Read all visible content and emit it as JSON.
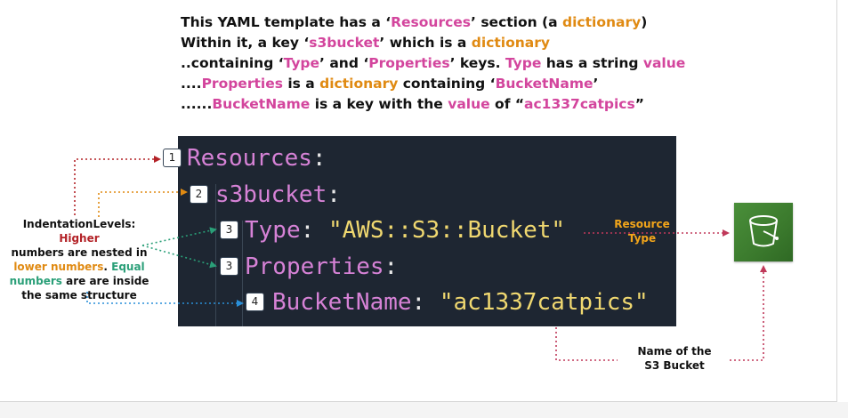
{
  "description": {
    "line1": [
      {
        "text": "This YAML template has a ‘",
        "color": "dark"
      },
      {
        "text": "Resources",
        "color": "pink"
      },
      {
        "text": "’ section (a ",
        "color": "dark"
      },
      {
        "text": "dictionary",
        "color": "orange"
      },
      {
        "text": ")",
        "color": "dark"
      }
    ],
    "line2": [
      {
        "text": "Within it, a key ‘",
        "color": "dark"
      },
      {
        "text": "s3bucket",
        "color": "pink"
      },
      {
        "text": "’ which is a ",
        "color": "dark"
      },
      {
        "text": "dictionary",
        "color": "orange"
      }
    ],
    "line3": [
      {
        "text": "..containing ‘",
        "color": "dark"
      },
      {
        "text": "Type",
        "color": "pink"
      },
      {
        "text": "’ and ‘",
        "color": "dark"
      },
      {
        "text": "Properties",
        "color": "pink"
      },
      {
        "text": "’ keys. ",
        "color": "dark"
      },
      {
        "text": "Type",
        "color": "pink"
      },
      {
        "text": " has a string ",
        "color": "dark"
      },
      {
        "text": "value",
        "color": "pink"
      }
    ],
    "line4": [
      {
        "text": "....",
        "color": "dark"
      },
      {
        "text": "Properties",
        "color": "pink"
      },
      {
        "text": " is a ",
        "color": "dark"
      },
      {
        "text": "dictionary",
        "color": "orange"
      },
      {
        "text": " containing ‘",
        "color": "dark"
      },
      {
        "text": "BucketName",
        "color": "pink"
      },
      {
        "text": "’",
        "color": "dark"
      }
    ],
    "line5": [
      {
        "text": "......",
        "color": "dark"
      },
      {
        "text": "BucketName",
        "color": "pink"
      },
      {
        "text": " is a key with the ",
        "color": "dark"
      },
      {
        "text": "value",
        "color": "pink"
      },
      {
        "text": " of “",
        "color": "dark"
      },
      {
        "text": "ac1337catpics",
        "color": "pink"
      },
      {
        "text": "”",
        "color": "dark"
      }
    ]
  },
  "code": {
    "levels": [
      "1",
      "2",
      "3",
      "3",
      "4"
    ],
    "line1": {
      "key": "Resources",
      "colon": ":"
    },
    "line2": {
      "key": "s3bucket",
      "colon": ":"
    },
    "line3": {
      "key": "Type",
      "colon": ": ",
      "value": "\"AWS::S3::Bucket\""
    },
    "line4": {
      "key": "Properties",
      "colon": ":"
    },
    "line5": {
      "key": "BucketName",
      "colon": ": ",
      "value": "\"ac1337catpics\""
    }
  },
  "indent_note": {
    "part1": "IndentationLevels: ",
    "part2": "Higher",
    "part3": "numbers are nested in",
    "part4": "lower numbers",
    "part5": ". ",
    "part6": "Equal",
    "part7": "numbers",
    "part8": " are are inside",
    "part9": "the same structure"
  },
  "resource_type_label": {
    "line1": "Resource",
    "line2": "Type"
  },
  "bucket_name_label": {
    "line1": "Name of the",
    "line2": "S3 Bucket"
  },
  "icons": {
    "s3": "s3-bucket-icon"
  },
  "colors": {
    "pink": "#d3459d",
    "orange": "#e08a12",
    "red": "#b32227",
    "green": "#2a9f78",
    "blue": "#2a8fd8",
    "code_bg": "#1e2632",
    "s3_green": "#3b7a2d"
  }
}
